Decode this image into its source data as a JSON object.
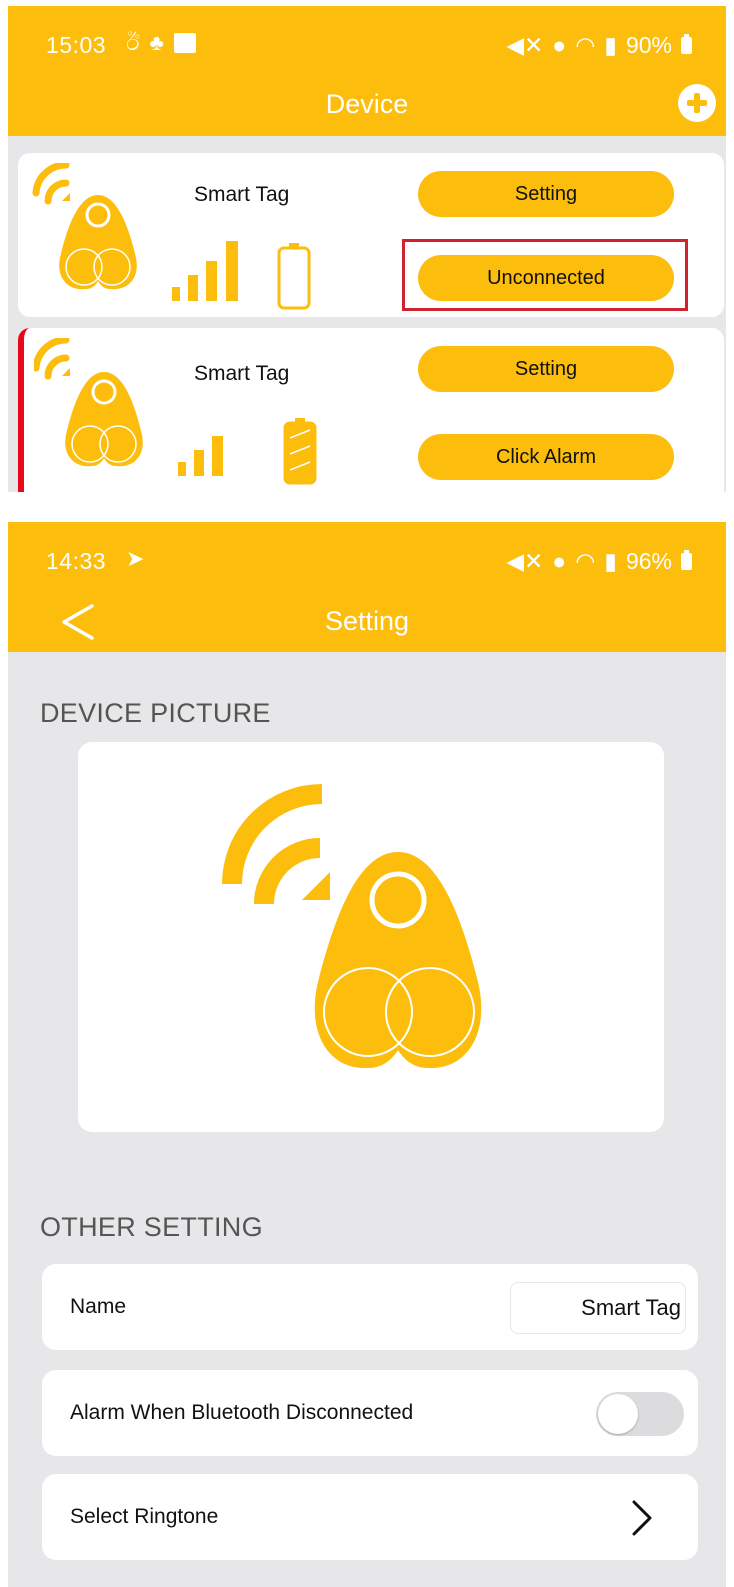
{
  "colors": {
    "accent": "#fcbd0c",
    "highlight_box": "#d0232f",
    "alert_edge": "#e8081a",
    "background": "#e7e7e9"
  },
  "device_screen": {
    "status": {
      "time": "15:03",
      "battery": "90%"
    },
    "title": "Device",
    "add_icon": "plus-circle-icon",
    "devices": [
      {
        "name": "Smart Tag",
        "setting_label": "Setting",
        "action_label": "Unconnected",
        "battery_level": 0.0
      },
      {
        "name": "Smart Tag",
        "setting_label": "Setting",
        "action_label": "Click Alarm",
        "battery_level": 1.0
      }
    ]
  },
  "setting_screen": {
    "status": {
      "time": "14:33",
      "battery": "96%"
    },
    "title": "Setting",
    "back_icon": "chevron-left-icon",
    "device_picture_label": "DEVICE PICTURE",
    "other_setting_label": "OTHER SETTING",
    "rows": {
      "name_label": "Name",
      "name_value": "Smart Tag",
      "alarm_label": "Alarm When Bluetooth Disconnected",
      "alarm_enabled": false,
      "ringtone_label": "Select Ringtone"
    }
  }
}
